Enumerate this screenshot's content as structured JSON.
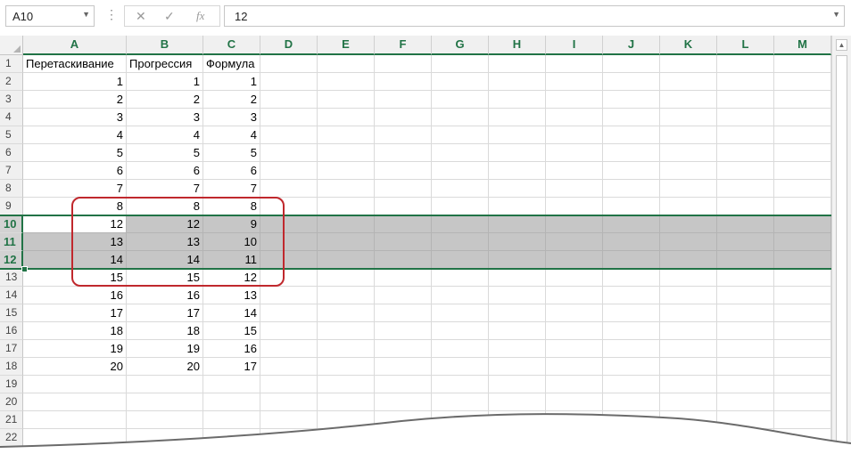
{
  "name_box": {
    "value": "A10"
  },
  "formula_bar": {
    "value": "12",
    "fx_label": "fx"
  },
  "columns": [
    "A",
    "B",
    "C",
    "D",
    "E",
    "F",
    "G",
    "H",
    "I",
    "J",
    "K",
    "L",
    "M"
  ],
  "rows": [
    {
      "n": "1",
      "a": "Перетаскивание",
      "b": "Прогрессия",
      "c": "Формула"
    },
    {
      "n": "2",
      "a": "1",
      "b": "1",
      "c": "1"
    },
    {
      "n": "3",
      "a": "2",
      "b": "2",
      "c": "2"
    },
    {
      "n": "4",
      "a": "3",
      "b": "3",
      "c": "3"
    },
    {
      "n": "5",
      "a": "4",
      "b": "4",
      "c": "4"
    },
    {
      "n": "6",
      "a": "5",
      "b": "5",
      "c": "5"
    },
    {
      "n": "7",
      "a": "6",
      "b": "6",
      "c": "6"
    },
    {
      "n": "8",
      "a": "7",
      "b": "7",
      "c": "7"
    },
    {
      "n": "9",
      "a": "8",
      "b": "8",
      "c": "8"
    },
    {
      "n": "10",
      "a": "12",
      "b": "12",
      "c": "9"
    },
    {
      "n": "11",
      "a": "13",
      "b": "13",
      "c": "10"
    },
    {
      "n": "12",
      "a": "14",
      "b": "14",
      "c": "11"
    },
    {
      "n": "13",
      "a": "15",
      "b": "15",
      "c": "12"
    },
    {
      "n": "14",
      "a": "16",
      "b": "16",
      "c": "13"
    },
    {
      "n": "15",
      "a": "17",
      "b": "17",
      "c": "14"
    },
    {
      "n": "16",
      "a": "18",
      "b": "18",
      "c": "15"
    },
    {
      "n": "17",
      "a": "19",
      "b": "19",
      "c": "16"
    },
    {
      "n": "18",
      "a": "20",
      "b": "20",
      "c": "17"
    },
    {
      "n": "19",
      "a": "",
      "b": "",
      "c": ""
    },
    {
      "n": "20",
      "a": "",
      "b": "",
      "c": ""
    },
    {
      "n": "21",
      "a": "",
      "b": "",
      "c": ""
    },
    {
      "n": "22",
      "a": "",
      "b": "",
      "c": ""
    }
  ],
  "selected_rows": [
    "10",
    "11",
    "12"
  ],
  "colors": {
    "accent": "#217346",
    "selection": "#c6c6c6",
    "highlight_box": "#c0282d"
  }
}
